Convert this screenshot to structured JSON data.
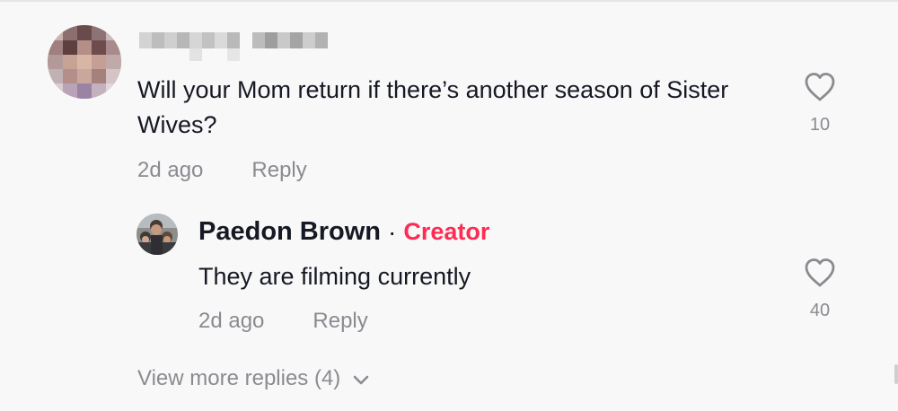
{
  "comment": {
    "author_redacted": true,
    "text": "Will your Mom return if there’s another season of Sister Wives?",
    "time": "2d ago",
    "reply_label": "Reply",
    "like_count": "10",
    "like_icon": "heart-outline"
  },
  "reply": {
    "author": "Paedon Brown",
    "separator": "·",
    "badge": "Creator",
    "badge_color": "#fe2c55",
    "text": "They are filming currently",
    "time": "2d ago",
    "reply_label": "Reply",
    "like_count": "40",
    "like_icon": "heart-outline"
  },
  "view_more": {
    "label": "View more replies (4)",
    "icon": "chevron-down"
  },
  "colors": {
    "background": "#f8f8f8",
    "text_primary": "#161823",
    "text_secondary": "#8a8b91",
    "accent": "#fe2c55"
  }
}
